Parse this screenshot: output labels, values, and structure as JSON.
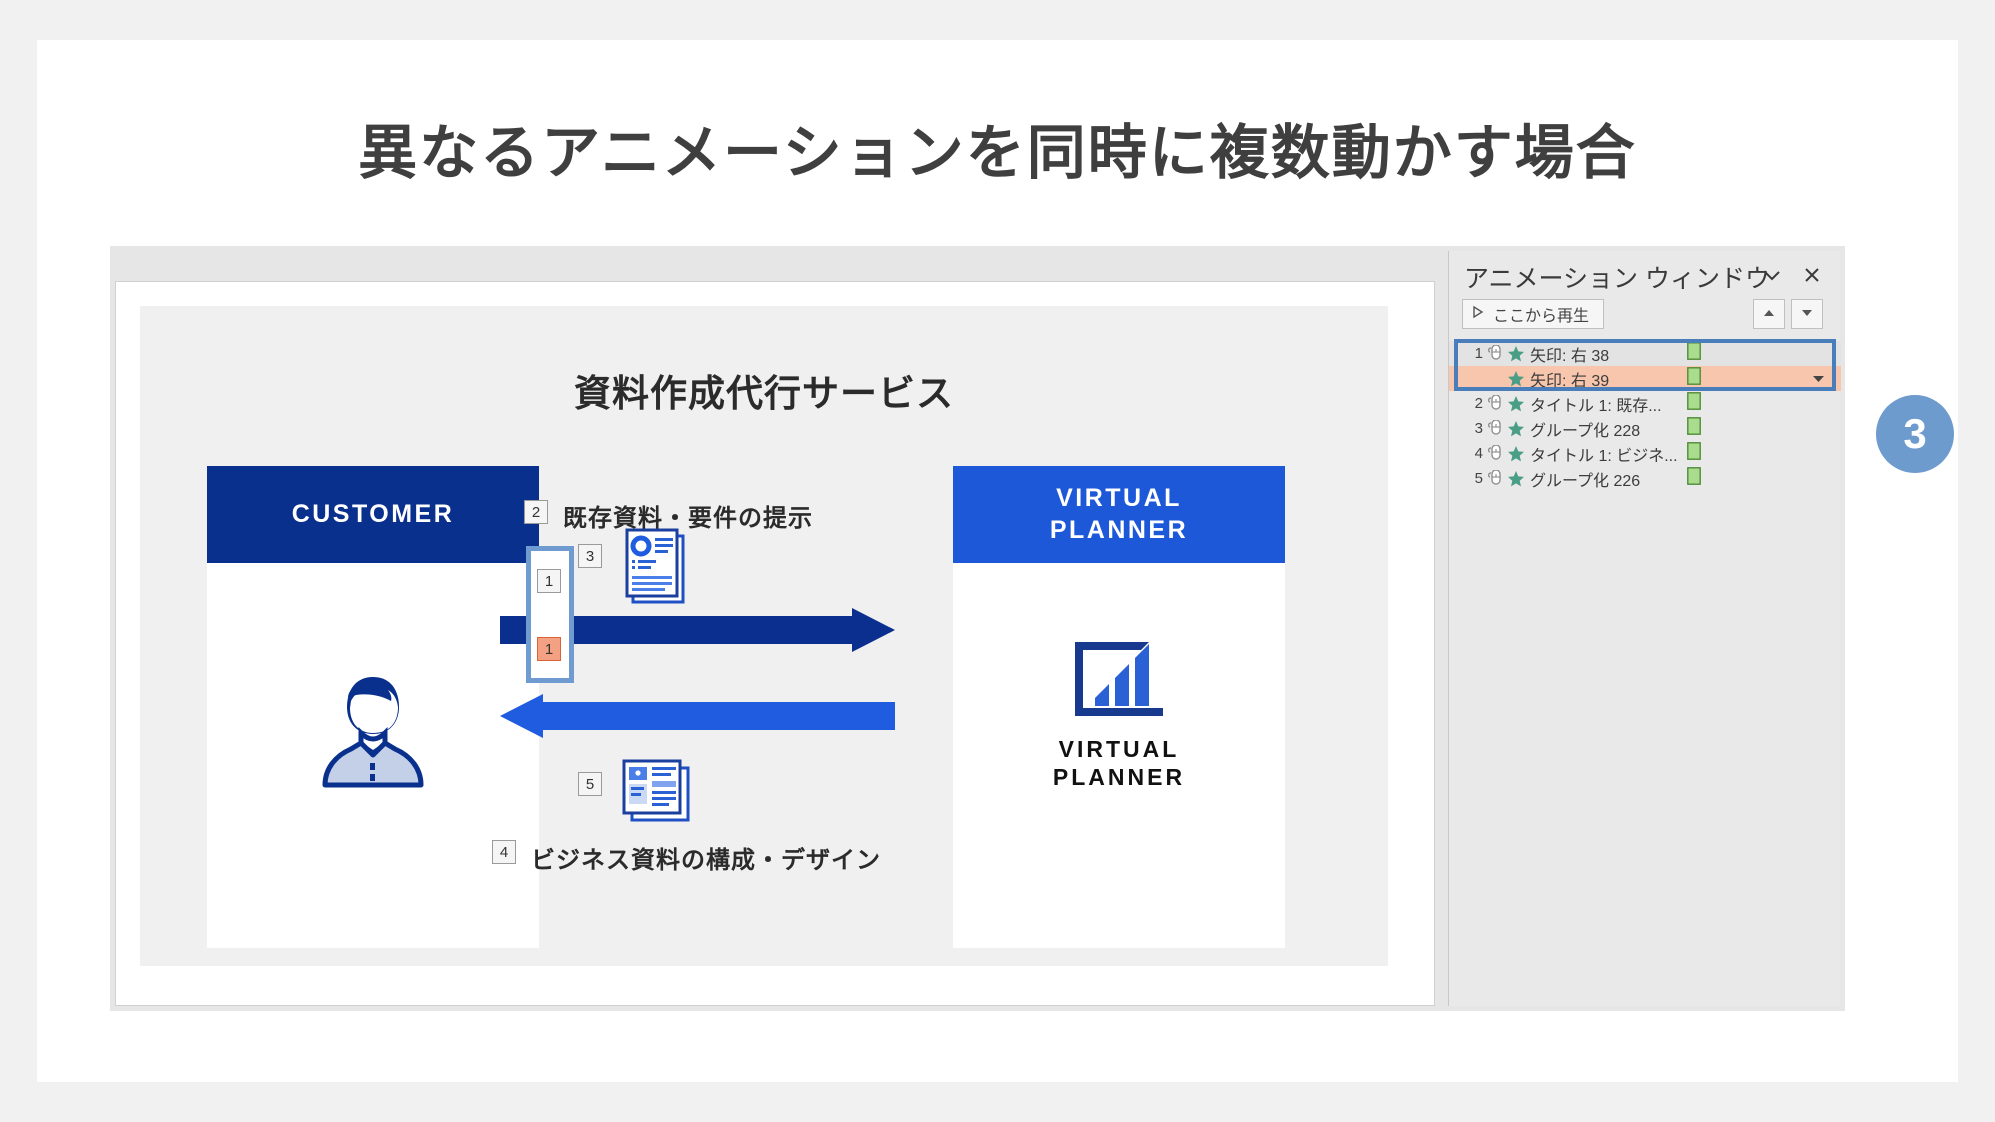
{
  "heading": "異なるアニメーションを同時に複数動かす場合",
  "slide": {
    "title": "資料作成代行サービス",
    "customer": {
      "heading": "CUSTOMER",
      "icon": "person-icon"
    },
    "planner": {
      "heading_line1": "VIRTUAL",
      "heading_line2": "PLANNER",
      "logo_icon": "bar-chart-logo-icon",
      "logo_line1": "VIRTUAL",
      "logo_line2": "PLANNER"
    },
    "arrows": {
      "top": {
        "name": "arrow-right-top",
        "color": "#0a2f8f",
        "direction": "right"
      },
      "bottom": {
        "name": "arrow-left-bottom",
        "color": "#1f5ce0",
        "direction": "left"
      }
    },
    "labels": {
      "top_text": "既存資料・要件の提示",
      "bottom_text": "ビジネス資料の構成・デザイン"
    },
    "tags": {
      "arrow_top_tag": "1",
      "arrow_bottom_tag": "1",
      "label_top_tag": "2",
      "doc_top_tag": "3",
      "label_bottom_tag": "4",
      "doc_bottom_tag": "5"
    },
    "icons": {
      "doc_top": "document-stack-icon",
      "doc_bottom": "presentation-slide-icon"
    }
  },
  "anim_pane": {
    "title": "アニメーション ウィンドウ",
    "collapse_icon": "chevron-down-icon",
    "close_icon": "close-icon",
    "play_button_label": "ここから再生",
    "play_icon": "play-triangle-icon",
    "move_up_icon": "triangle-up-icon",
    "move_down_icon": "triangle-down-icon",
    "rows": [
      {
        "index": "1",
        "label": "矢印: 右 38",
        "trigger": "mouse-click-icon",
        "effect": "star-green-icon",
        "bar": true,
        "selected": false,
        "grouped": true,
        "caret": false
      },
      {
        "index": "",
        "label": "矢印: 右 39",
        "trigger": "",
        "effect": "star-green-icon",
        "bar": true,
        "selected": true,
        "grouped": false,
        "caret": true
      },
      {
        "index": "2",
        "label": "タイトル 1: 既存...",
        "trigger": "mouse-click-icon",
        "effect": "star-green-icon",
        "bar": true,
        "selected": false,
        "grouped": false,
        "caret": false
      },
      {
        "index": "3",
        "label": "グループ化 228",
        "trigger": "mouse-click-icon",
        "effect": "star-green-icon",
        "bar": true,
        "selected": false,
        "grouped": false,
        "caret": false
      },
      {
        "index": "4",
        "label": "タイトル 1: ビジネ...",
        "trigger": "mouse-click-icon",
        "effect": "star-green-icon",
        "bar": true,
        "selected": false,
        "grouped": false,
        "caret": false
      },
      {
        "index": "5",
        "label": "グループ化 226",
        "trigger": "mouse-click-icon",
        "effect": "star-green-icon",
        "bar": true,
        "selected": false,
        "grouped": false,
        "caret": false
      }
    ]
  },
  "callout": {
    "number": "3",
    "color": "#6d9bcd"
  }
}
